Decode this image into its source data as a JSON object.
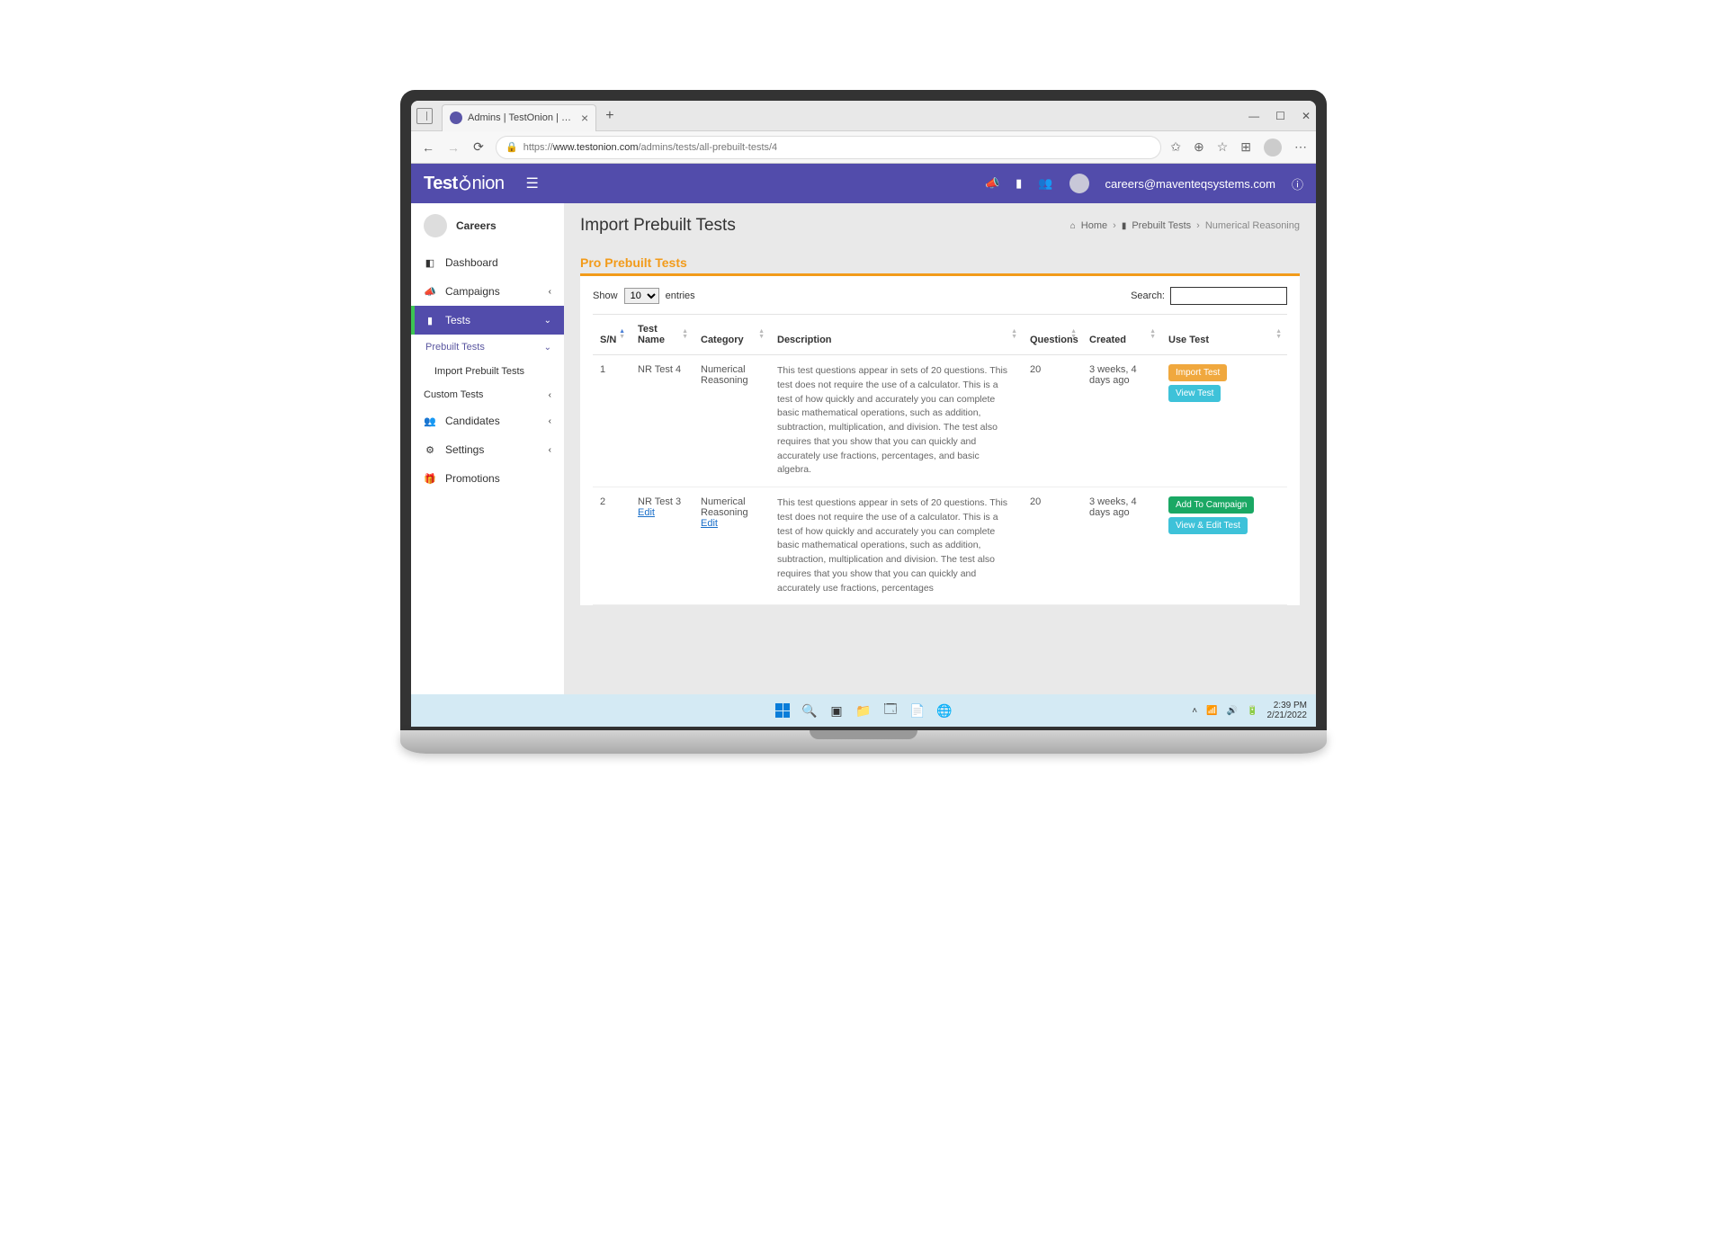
{
  "browser": {
    "tab_title": "Admins | TestOnion | Create and",
    "url_prefix": "https://",
    "url_domain": "www.testonion.com",
    "url_path": "/admins/tests/all-prebuilt-tests/4"
  },
  "app_top": {
    "logo_part1": "Test",
    "logo_part2": "nion",
    "user_email": "careers@maventeqsystems.com"
  },
  "sidebar": {
    "user_name": "Careers",
    "items": {
      "dashboard": "Dashboard",
      "campaigns": "Campaigns",
      "tests": "Tests",
      "prebuilt_tests": "Prebuilt Tests",
      "import_prebuilt_tests": "Import Prebuilt Tests",
      "custom_tests": "Custom Tests",
      "candidates": "Candidates",
      "settings": "Settings",
      "promotions": "Promotions"
    }
  },
  "page": {
    "title": "Import Prebuilt Tests",
    "crumbs": {
      "home": "Home",
      "prebuilt": "Prebuilt Tests",
      "current": "Numerical Reasoning"
    },
    "section_title": "Pro Prebuilt Tests"
  },
  "table": {
    "show_label": "Show",
    "entries_label": "entries",
    "entries_value": "10",
    "search_label": "Search:",
    "headers": {
      "sn": "S/N",
      "test_name": "Test Name",
      "category": "Category",
      "description": "Description",
      "questions": "Questions",
      "created": "Created",
      "use_test": "Use Test"
    },
    "rows": [
      {
        "sn": "1",
        "name": "NR Test 4",
        "name_edit": "",
        "category": "Numerical Reasoning",
        "category_edit": "",
        "description": "This test questions appear in sets of 20 questions. This test does not require the use of a calculator. This is a test of how quickly and accurately you can complete basic mathematical operations, such as addition, subtraction, multiplication, and division. The test also requires that you show that you can quickly and accurately use fractions, percentages, and basic algebra.",
        "questions": "20",
        "created": "3 weeks, 4 days ago",
        "btn1": "Import Test",
        "btn1_class": "btn-orange",
        "btn2": "View Test",
        "btn2_class": "btn-teal"
      },
      {
        "sn": "2",
        "name": "NR Test 3",
        "name_edit": "Edit",
        "category": "Numerical Reasoning",
        "category_edit": "Edit",
        "description": "This test questions appear in sets of 20 questions. This test does not require the use of a calculator. This is a test of how quickly and accurately you can complete basic mathematical operations, such as addition, subtraction, multiplication and division. The test also requires that you show that you can quickly and accurately use fractions, percentages",
        "questions": "20",
        "created": "3 weeks, 4 days ago",
        "btn1": "Add To Campaign",
        "btn1_class": "btn-green",
        "btn2": "View & Edit Test",
        "btn2_class": "btn-teal"
      }
    ]
  },
  "taskbar": {
    "time": "2:39 PM",
    "date": "2/21/2022"
  }
}
